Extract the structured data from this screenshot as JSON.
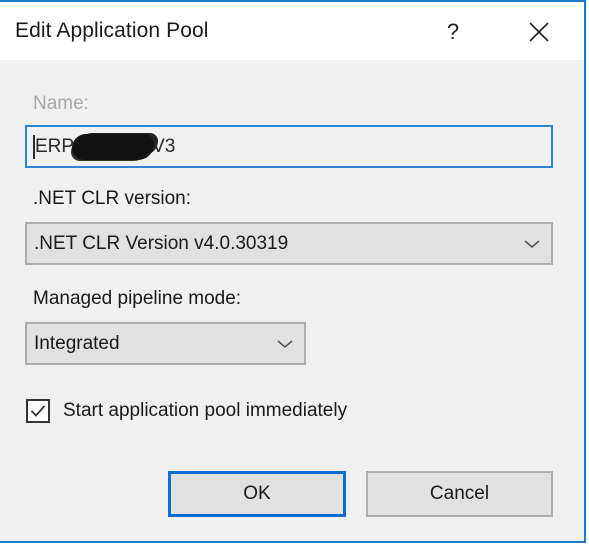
{
  "window": {
    "title": "Edit Application Pool",
    "help_label": "?",
    "close_icon": "close-icon"
  },
  "form": {
    "name": {
      "label": "Name:",
      "value_prefix": "ERP",
      "value_suffix": "V3",
      "redacted": true,
      "disabled_label": true
    },
    "clr_version": {
      "label": ".NET CLR version:",
      "selected": ".NET CLR Version v4.0.30319"
    },
    "pipeline_mode": {
      "label": "Managed pipeline mode:",
      "selected": "Integrated"
    },
    "start_immediately": {
      "label": "Start application pool immediately",
      "checked": true
    }
  },
  "buttons": {
    "ok": "OK",
    "cancel": "Cancel"
  },
  "colors": {
    "accent_border": "#1979ca",
    "focus_border": "#2a86d8",
    "body_bg": "#f0f0f0",
    "button_bg": "#e1e1e1"
  }
}
